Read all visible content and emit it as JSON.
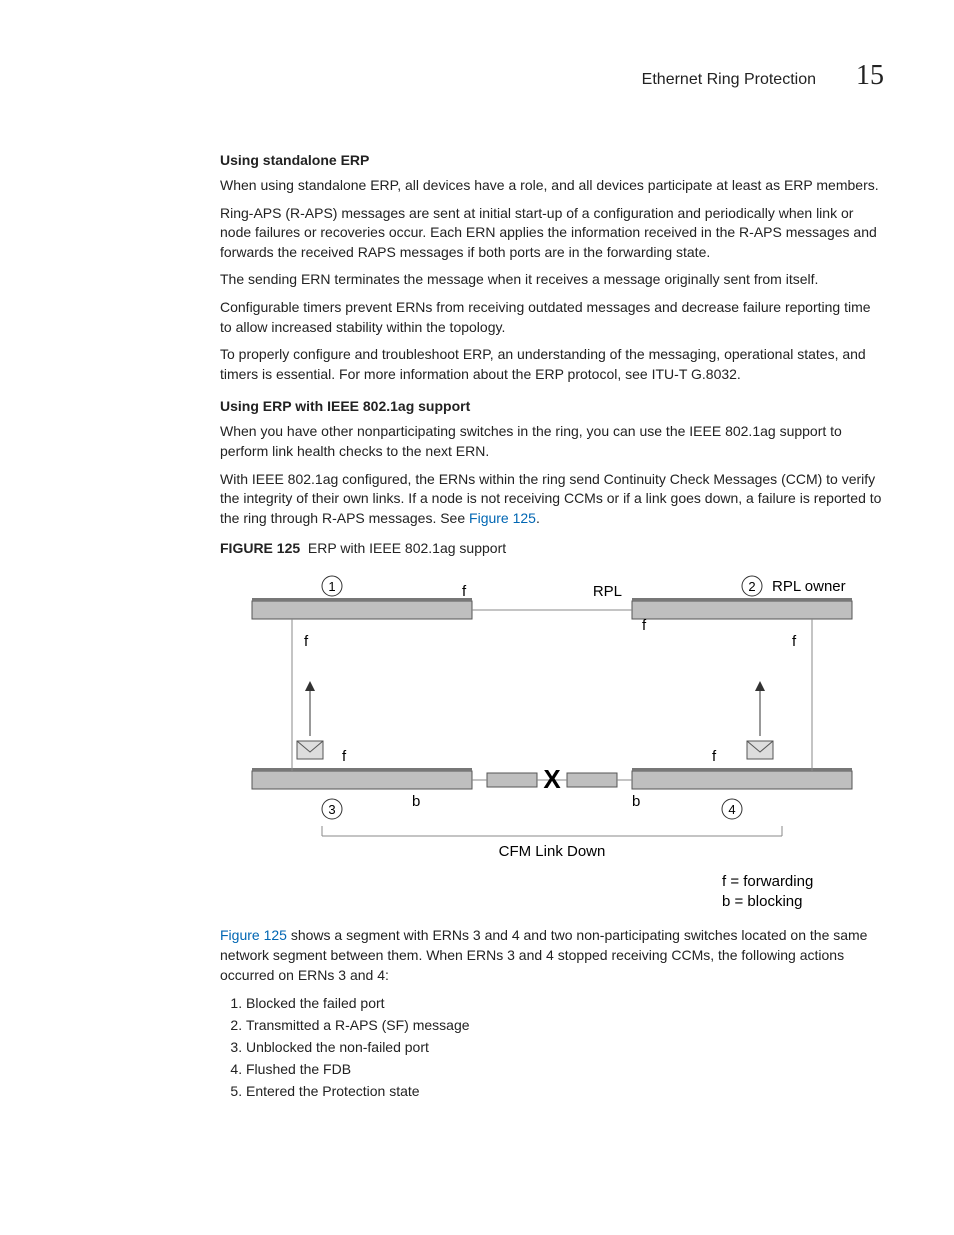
{
  "header": {
    "title": "Ethernet Ring Protection",
    "chapter": "15"
  },
  "s1": {
    "heading": "Using standalone ERP",
    "p1": "When using standalone ERP, all devices have a role, and all devices participate at least as ERP members.",
    "p2": "Ring-APS (R-APS) messages are sent at initial start-up of a configuration and periodically when link or node failures or recoveries occur. Each ERN applies the information received in the R-APS messages and forwards the received RAPS messages if both ports are in the forwarding state.",
    "p3": "The sending ERN terminates the message when it receives a message originally sent from itself.",
    "p4": "Configurable timers prevent ERNs from receiving outdated messages and decrease failure reporting time to allow increased stability within the topology.",
    "p5": "To properly configure and troubleshoot ERP, an understanding of the messaging, operational states, and timers is essential. For more information about the ERP protocol, see ITU-T G.8032."
  },
  "s2": {
    "heading": "Using ERP with IEEE 802.1ag support",
    "p1": "When you have other nonparticipating switches in the ring, you can use the IEEE 802.1ag support to perform link health checks to the next ERN.",
    "p2a": "With IEEE 802.1ag configured, the ERNs within the ring send Continuity Check Messages (CCM) to verify the integrity of their own links. If a node is not receiving CCMs or if a link goes down, a failure is reported to the ring through R-APS messages. See ",
    "p2_link": "Figure 125",
    "p2b": "."
  },
  "figure": {
    "label": "FIGURE 125",
    "title": "ERP with IEEE 802.1ag support",
    "rpl": "RPL",
    "rpl_owner": "RPL owner",
    "f": "f",
    "b": "b",
    "x": "X",
    "n1": "1",
    "n2": "2",
    "n3": "3",
    "n4": "4",
    "cfm": "CFM Link Down",
    "legend_f": "f = forwarding",
    "legend_b": "b = blocking"
  },
  "after": {
    "p_link": "Figure 125",
    "p_rest": " shows a segment with ERNs 3 and 4 and two non-participating switches located on the same network segment between them. When ERNs 3 and 4 stopped receiving CCMs, the following actions occurred on ERNs 3 and 4:",
    "steps": [
      "Blocked the failed port",
      "Transmitted a R-APS (SF) message",
      "Unblocked the non-failed port",
      "Flushed the FDB",
      "Entered the Protection state"
    ]
  }
}
